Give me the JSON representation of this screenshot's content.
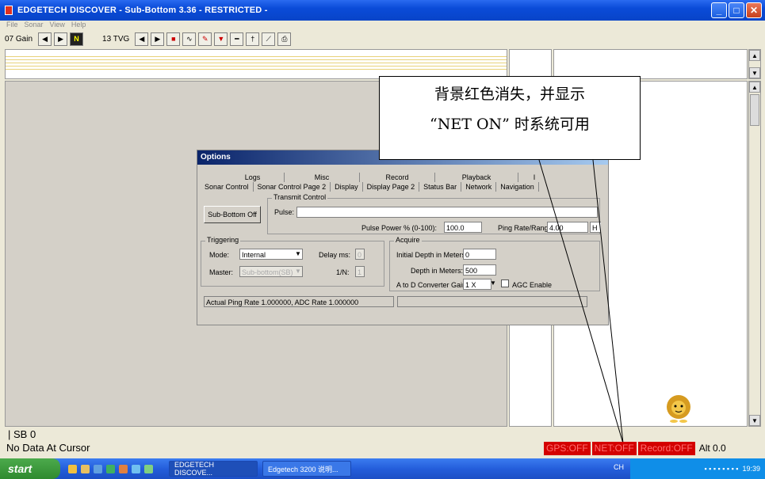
{
  "window": {
    "title": "EDGETECH DISCOVER - Sub-Bottom 3.36 - RESTRICTED -"
  },
  "menu": [
    "File",
    "Sonar",
    "View",
    "Help"
  ],
  "toolbar": {
    "gain_label": "07 Gain",
    "tvg_label": "13 TVG"
  },
  "callout": {
    "line1": "背景红色消失，并显示",
    "line2": "“NET ON” 时系统可用"
  },
  "dialog": {
    "title": "Options",
    "tabs_row1": [
      "Logs",
      "Misc",
      "Record",
      "Playback",
      "I"
    ],
    "tabs_row2": [
      "Sonar Control",
      "Sonar Control Page 2",
      "Display",
      "Display Page 2",
      "Status Bar",
      "Network",
      "Navigation"
    ],
    "transmit_group": "Transmit Control",
    "sub_bottom_off": "Sub-Bottom Off",
    "pulse_label": "Pulse:",
    "pulse_power_label": "Pulse Power % (0-100):",
    "pulse_power_value": "100.0",
    "ping_rate_label": "Ping Rate/Range:",
    "ping_rate_value": "4.00",
    "ping_rate_unit": "H",
    "triggering_group": "Triggering",
    "mode_label": "Mode:",
    "mode_value": "Internal",
    "delay_label": "Delay ms:",
    "delay_value": "0",
    "master_label": "Master:",
    "master_value": "Sub-bottom(SB)",
    "one_n_label": "1/N:",
    "one_n_value": "1",
    "acquire_group": "Acquire",
    "initial_depth_label": "Initial Depth in Meters:",
    "initial_depth_value": "0",
    "depth_label": "Depth in Meters:",
    "depth_value": "500",
    "adc_gain_label": "A to D Converter Gain",
    "adc_gain_value": "1 X",
    "agc_label": "AGC Enable",
    "status_text": "Actual Ping Rate 1.000000, ADC Rate 1.000000"
  },
  "status": {
    "sb": "| SB 0",
    "cursor": "No Data At Cursor",
    "gps": "GPS:OFF",
    "net": "NET:OFF",
    "record": "Record:OFF",
    "alt": "Alt 0.0"
  },
  "taskbar": {
    "start": "start",
    "task1": "EDGETECH DISCOVE...",
    "task2": "Edgetech 3200 说明...",
    "lang": "CH",
    "clock": "19:39"
  },
  "colors": {
    "status_red": "#d40000",
    "title_blue": "#0a4bd8"
  }
}
